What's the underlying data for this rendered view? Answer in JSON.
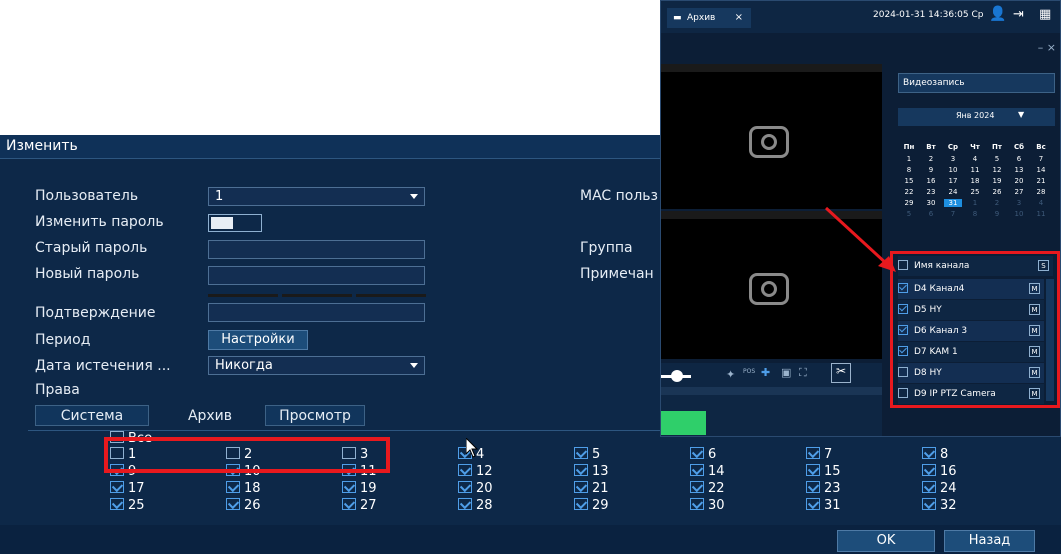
{
  "dialog": {
    "title": "Изменить",
    "labels": {
      "user": "Пользователь",
      "change_password": "Изменить пароль",
      "old_password": "Старый пароль",
      "new_password": "Новый пароль",
      "confirm": "Подтверждение",
      "period": "Период",
      "expiry": "Дата истечения ...",
      "rights": "Права",
      "mac": "MAC польз",
      "group": "Группа",
      "note": "Примечан"
    },
    "user_value": "1",
    "period_button": "Настройки",
    "expiry_value": "Никогда",
    "tabs": [
      "Система",
      "Архив",
      "Просмотр"
    ],
    "all_label": "Все",
    "channels": [
      {
        "n": "1",
        "checked": false
      },
      {
        "n": "2",
        "checked": false
      },
      {
        "n": "3",
        "checked": false
      },
      {
        "n": "4",
        "checked": true
      },
      {
        "n": "5",
        "checked": true
      },
      {
        "n": "6",
        "checked": true
      },
      {
        "n": "7",
        "checked": true
      },
      {
        "n": "8",
        "checked": true
      },
      {
        "n": "9",
        "checked": true
      },
      {
        "n": "10",
        "checked": true
      },
      {
        "n": "11",
        "checked": true
      },
      {
        "n": "12",
        "checked": true
      },
      {
        "n": "13",
        "checked": true
      },
      {
        "n": "14",
        "checked": true
      },
      {
        "n": "15",
        "checked": true
      },
      {
        "n": "16",
        "checked": true
      },
      {
        "n": "17",
        "checked": true
      },
      {
        "n": "18",
        "checked": true
      },
      {
        "n": "19",
        "checked": true
      },
      {
        "n": "20",
        "checked": true
      },
      {
        "n": "21",
        "checked": true
      },
      {
        "n": "22",
        "checked": true
      },
      {
        "n": "23",
        "checked": true
      },
      {
        "n": "24",
        "checked": true
      },
      {
        "n": "25",
        "checked": true
      },
      {
        "n": "26",
        "checked": true
      },
      {
        "n": "27",
        "checked": true
      },
      {
        "n": "28",
        "checked": true
      },
      {
        "n": "29",
        "checked": true
      },
      {
        "n": "30",
        "checked": true
      },
      {
        "n": "31",
        "checked": true
      },
      {
        "n": "32",
        "checked": true
      }
    ],
    "ok": "OK",
    "back": "Назад",
    "highlight_color": "#e8191e",
    "accent": "#4f9ee8"
  },
  "playback": {
    "tab_title": "Архив",
    "datetime": "2024-01-31 14:36:05 Ср",
    "record_type": "Видеозапись",
    "month": "Янв 2024",
    "weekdays": [
      "Пн",
      "Вт",
      "Ср",
      "Чт",
      "Пт",
      "Сб",
      "Вс"
    ],
    "days": [
      [
        "1",
        "2",
        "3",
        "4",
        "5",
        "6",
        "7"
      ],
      [
        "8",
        "9",
        "10",
        "11",
        "12",
        "13",
        "14"
      ],
      [
        "15",
        "16",
        "17",
        "18",
        "19",
        "20",
        "21"
      ],
      [
        "22",
        "23",
        "24",
        "25",
        "26",
        "27",
        "28"
      ],
      [
        "29",
        "30",
        "31",
        "1",
        "2",
        "3",
        "4"
      ],
      [
        "5",
        "6",
        "7",
        "8",
        "9",
        "10",
        "11"
      ]
    ],
    "selected_day": "31",
    "channel_header": "Имя канала",
    "channel_header_badge": "S",
    "channels": [
      {
        "name": "D4 Канал4",
        "checked": true
      },
      {
        "name": "D5 HY",
        "checked": true
      },
      {
        "name": "D6 Канал 3",
        "checked": true
      },
      {
        "name": "D7 KAM 1",
        "checked": true
      },
      {
        "name": "D8 HY",
        "checked": false
      },
      {
        "name": "D9 IP PTZ Camera",
        "checked": false
      }
    ],
    "channel_badge": "M",
    "timeline_pos": "POS"
  }
}
